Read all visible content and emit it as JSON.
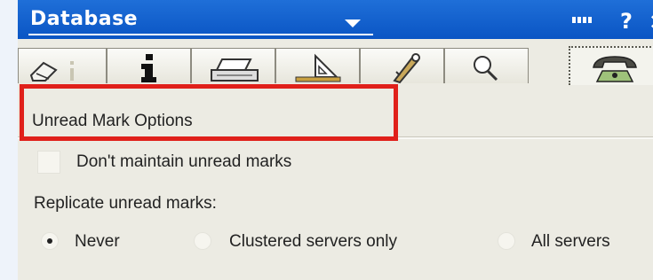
{
  "window": {
    "title": "Database",
    "help_glyph": "?",
    "close_glyph": "×"
  },
  "tabs": [
    {
      "icon": "eraser-icon"
    },
    {
      "icon": "info-icon"
    },
    {
      "icon": "printer-icon"
    },
    {
      "icon": "drafting-triangle-icon"
    },
    {
      "icon": "key-icon"
    },
    {
      "icon": "magnifier-icon"
    },
    {
      "icon": "telephone-icon",
      "active": true
    }
  ],
  "section": {
    "title": "Unread Mark Options"
  },
  "options": {
    "dont_maintain_label": "Don't maintain unread marks",
    "dont_maintain_checked": false,
    "replicate_label": "Replicate unread marks:",
    "replicate_choices": [
      {
        "label": "Never",
        "selected": true
      },
      {
        "label": "Clustered servers only",
        "selected": false
      },
      {
        "label": "All servers",
        "selected": false
      }
    ]
  },
  "colors": {
    "title_bar": "#0a55c4",
    "panel": "#ecebe3",
    "highlight": "#e0201a"
  }
}
